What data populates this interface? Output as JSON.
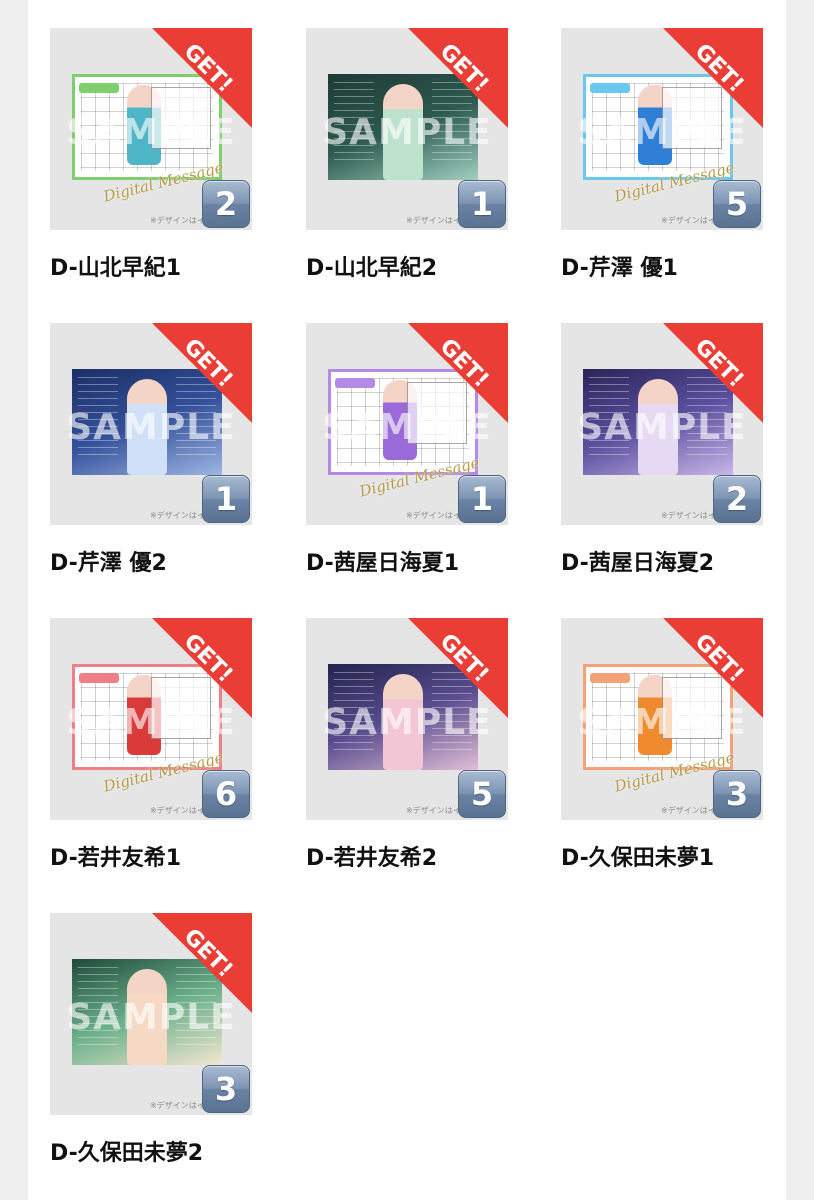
{
  "get_badge": "GET!",
  "watermark": "SAMPLE",
  "note": "※デザインはイ",
  "items": [
    {
      "title": "D-山北早紀1",
      "count": "2",
      "style": "frame",
      "frame_color": "#7fcf6f",
      "figure_color": "#4fb6c8",
      "script": "Digital Message"
    },
    {
      "title": "D-山北早紀2",
      "count": "1",
      "style": "live",
      "bg": [
        "#1f3a35",
        "#2d5a4e",
        "#9fd0c0"
      ],
      "figure_color": "#bde3cf",
      "script": ""
    },
    {
      "title": "D-芹澤 優1",
      "count": "5",
      "style": "frame",
      "frame_color": "#6cc7ef",
      "figure_color": "#2f7fd6",
      "script": "Digital Message"
    },
    {
      "title": "D-芹澤 優2",
      "count": "1",
      "style": "live",
      "bg": [
        "#1c2f66",
        "#34509a",
        "#9db6e3"
      ],
      "figure_color": "#cfe0f8",
      "script": ""
    },
    {
      "title": "D-茜屋日海夏1",
      "count": "1",
      "style": "frame",
      "frame_color": "#b48ae6",
      "figure_color": "#9a6ad9",
      "script": "Digital Message"
    },
    {
      "title": "D-茜屋日海夏2",
      "count": "2",
      "style": "live",
      "bg": [
        "#2a2457",
        "#5a4f9e",
        "#c9b6e8"
      ],
      "figure_color": "#e5d9f3",
      "script": ""
    },
    {
      "title": "D-若井友希1",
      "count": "6",
      "style": "frame",
      "frame_color": "#ee7f86",
      "figure_color": "#d93a3a",
      "script": "Digital Message"
    },
    {
      "title": "D-若井友希2",
      "count": "5",
      "style": "live",
      "bg": [
        "#22234d",
        "#5a4d8f",
        "#e2bfd6"
      ],
      "figure_color": "#f3c6d6",
      "script": ""
    },
    {
      "title": "D-久保田未夢1",
      "count": "3",
      "style": "frame",
      "frame_color": "#f3a277",
      "figure_color": "#f08a2e",
      "script": "Digital Message"
    },
    {
      "title": "D-久保田未夢2",
      "count": "3",
      "style": "live",
      "bg": [
        "#1f4a3a",
        "#6aaf8a",
        "#f3e7d0"
      ],
      "figure_color": "#f6d9c4",
      "script": ""
    }
  ]
}
